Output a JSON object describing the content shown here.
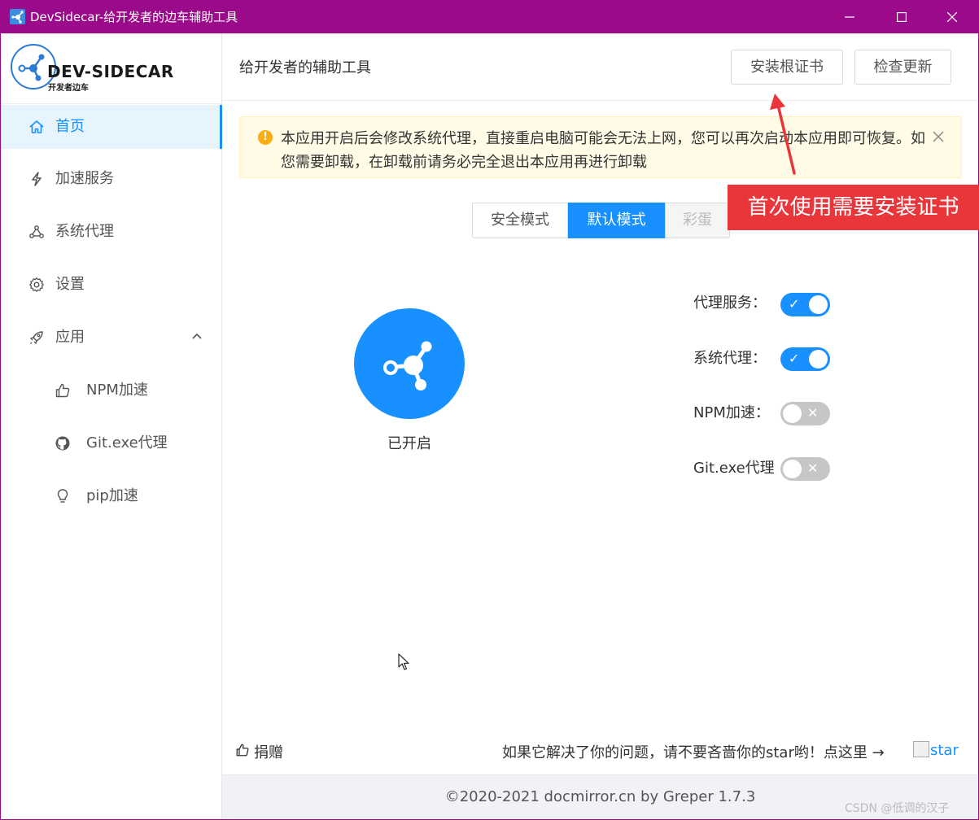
{
  "window": {
    "title": "DevSidecar-给开发者的边车辅助工具",
    "accent": "#9b0a8a"
  },
  "logo": {
    "name": "DEV-SIDECAR",
    "subtitle": "开发者边车"
  },
  "sidebar": {
    "items": [
      {
        "label": "首页",
        "icon": "home-icon",
        "active": true
      },
      {
        "label": "加速服务",
        "icon": "lightning-icon"
      },
      {
        "label": "系统代理",
        "icon": "share-nodes-icon"
      },
      {
        "label": "设置",
        "icon": "gear-icon"
      },
      {
        "label": "应用",
        "icon": "rocket-icon",
        "expanded": true
      }
    ],
    "subitems": [
      {
        "label": "NPM加速",
        "icon": "thumb-up-icon"
      },
      {
        "label": "Git.exe代理",
        "icon": "github-icon"
      },
      {
        "label": "pip加速",
        "icon": "bulb-icon"
      }
    ]
  },
  "header": {
    "title": "给开发者的辅助工具",
    "install_cert": "安装根证书",
    "check_update": "检查更新"
  },
  "alert": {
    "text": "本应用开启后会修改系统代理，直接重启电脑可能会无法上网，您可以再次启动本应用即可恢复。如您需要卸载，在卸载前请务必完全退出本应用再进行卸载"
  },
  "modes": {
    "safe": "安全模式",
    "default": "默认模式",
    "egg": "彩蛋",
    "selected": "默认模式"
  },
  "annotation": {
    "text": "首次使用需要安装证书",
    "color": "#e9363b"
  },
  "status": {
    "label": "已开启",
    "color": "#1890ff"
  },
  "switches": [
    {
      "label": "代理服务：",
      "on": true
    },
    {
      "label": "系统代理：",
      "on": true
    },
    {
      "label": "NPM加速：",
      "on": false
    },
    {
      "label": "Git.exe代理",
      "on": false
    }
  ],
  "bottom": {
    "donate": "捐赠",
    "star_prompt": "如果它解决了你的问题，请不要吝啬你的star哟！点这里 →",
    "star_alt": "star"
  },
  "footer": {
    "text": "©2020-2021 docmirror.cn by Greper  1.7.3",
    "watermark": "CSDN @低调的汉子"
  }
}
